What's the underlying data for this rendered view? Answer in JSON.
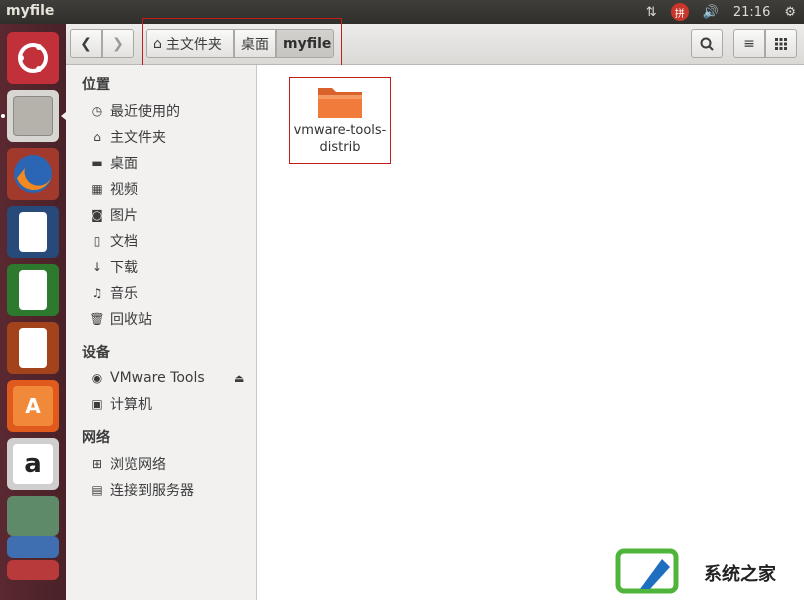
{
  "topbar": {
    "title": "myfile",
    "time": "21:16",
    "ime_label": "拼"
  },
  "toolbar": {
    "back_icon": "chevron-left-icon",
    "forward_icon": "chevron-right-icon",
    "breadcrumbs": [
      {
        "label": "主文件夹",
        "icon": "home-icon"
      },
      {
        "label": "桌面"
      },
      {
        "label": "myfile"
      }
    ],
    "search_icon": "search-icon",
    "list_view_icon": "list-view-icon",
    "grid_view_icon": "grid-view-icon"
  },
  "sidebar": {
    "section_places": "位置",
    "places": [
      {
        "label": "最近使用的",
        "icon": "clock-icon"
      },
      {
        "label": "主文件夹",
        "icon": "home-icon"
      },
      {
        "label": "桌面",
        "icon": "folder-icon"
      },
      {
        "label": "视频",
        "icon": "film-icon"
      },
      {
        "label": "图片",
        "icon": "camera-icon"
      },
      {
        "label": "文档",
        "icon": "document-icon"
      },
      {
        "label": "下载",
        "icon": "download-icon"
      },
      {
        "label": "音乐",
        "icon": "music-icon"
      },
      {
        "label": "回收站",
        "icon": "trash-icon"
      }
    ],
    "section_devices": "设备",
    "devices": [
      {
        "label": "VMware Tools",
        "icon": "disc-icon"
      },
      {
        "label": "计算机",
        "icon": "computer-icon"
      }
    ],
    "section_network": "网络",
    "network": [
      {
        "label": "浏览网络",
        "icon": "network-icon"
      },
      {
        "label": "连接到服务器",
        "icon": "server-icon"
      }
    ]
  },
  "content": {
    "items": [
      {
        "name": "vmware-tools-distrib",
        "type": "folder",
        "color": "#f07b3b"
      }
    ]
  },
  "watermark": {
    "text": "系统之家"
  },
  "colors": {
    "launcher_bg": "#5a2830",
    "toolbar_bg": "#dad9d6",
    "sidebar_bg": "#f2f1f0",
    "highlight_box": "#c41b1b"
  }
}
